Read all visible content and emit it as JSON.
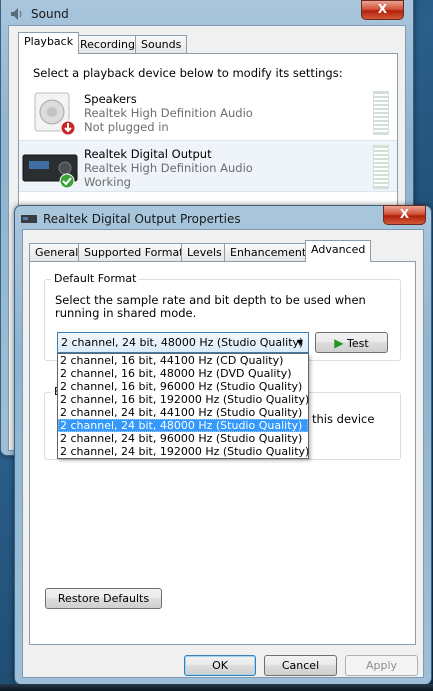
{
  "sound_window": {
    "title": "Sound",
    "close_glyph": "X",
    "tabs": [
      "Playback",
      "Recording",
      "Sounds"
    ],
    "instruction": "Select a playback device below to modify its settings:",
    "devices": [
      {
        "name": "Speakers",
        "driver": "Realtek High Definition Audio",
        "status": "Not plugged in",
        "icon": "speaker-icon",
        "badge": "unplugged-arrow-icon"
      },
      {
        "name": "Realtek Digital Output",
        "driver": "Realtek High Definition Audio",
        "status": "Working",
        "icon": "digital-receiver-icon",
        "badge": "check-icon"
      }
    ]
  },
  "properties_dialog": {
    "title": "Realtek Digital Output Properties",
    "close_glyph": "X",
    "tabs": [
      "General",
      "Supported Formats",
      "Levels",
      "Enhancements",
      "Advanced"
    ],
    "selected_tab": "Advanced",
    "default_format": {
      "group_label": "Default Format",
      "description": "Select the sample rate and bit depth to be used when running in shared mode.",
      "selected_value": "2 channel, 24 bit, 48000 Hz (Studio Quality)",
      "test_label": "Test",
      "options": [
        "2 channel, 16 bit, 44100 Hz (CD Quality)",
        "2 channel, 16 bit, 48000 Hz (DVD Quality)",
        "2 channel, 16 bit, 96000 Hz (Studio Quality)",
        "2 channel, 16 bit, 192000 Hz (Studio Quality)",
        "2 channel, 24 bit, 44100 Hz (Studio Quality)",
        "2 channel, 24 bit, 48000 Hz (Studio Quality)",
        "2 channel, 24 bit, 96000 Hz (Studio Quality)",
        "2 channel, 24 bit, 192000 Hz (Studio Quality)"
      ],
      "highlighted_index": 5
    },
    "exclusive_group": {
      "label_fragment": "E",
      "text_fragment": "this device"
    },
    "restore_defaults_label": "Restore Defaults",
    "buttons": {
      "ok": "OK",
      "cancel": "Cancel",
      "apply": "Apply"
    },
    "colors": {
      "selection": "#3399ff",
      "test_play": "#1f9a1f"
    }
  }
}
